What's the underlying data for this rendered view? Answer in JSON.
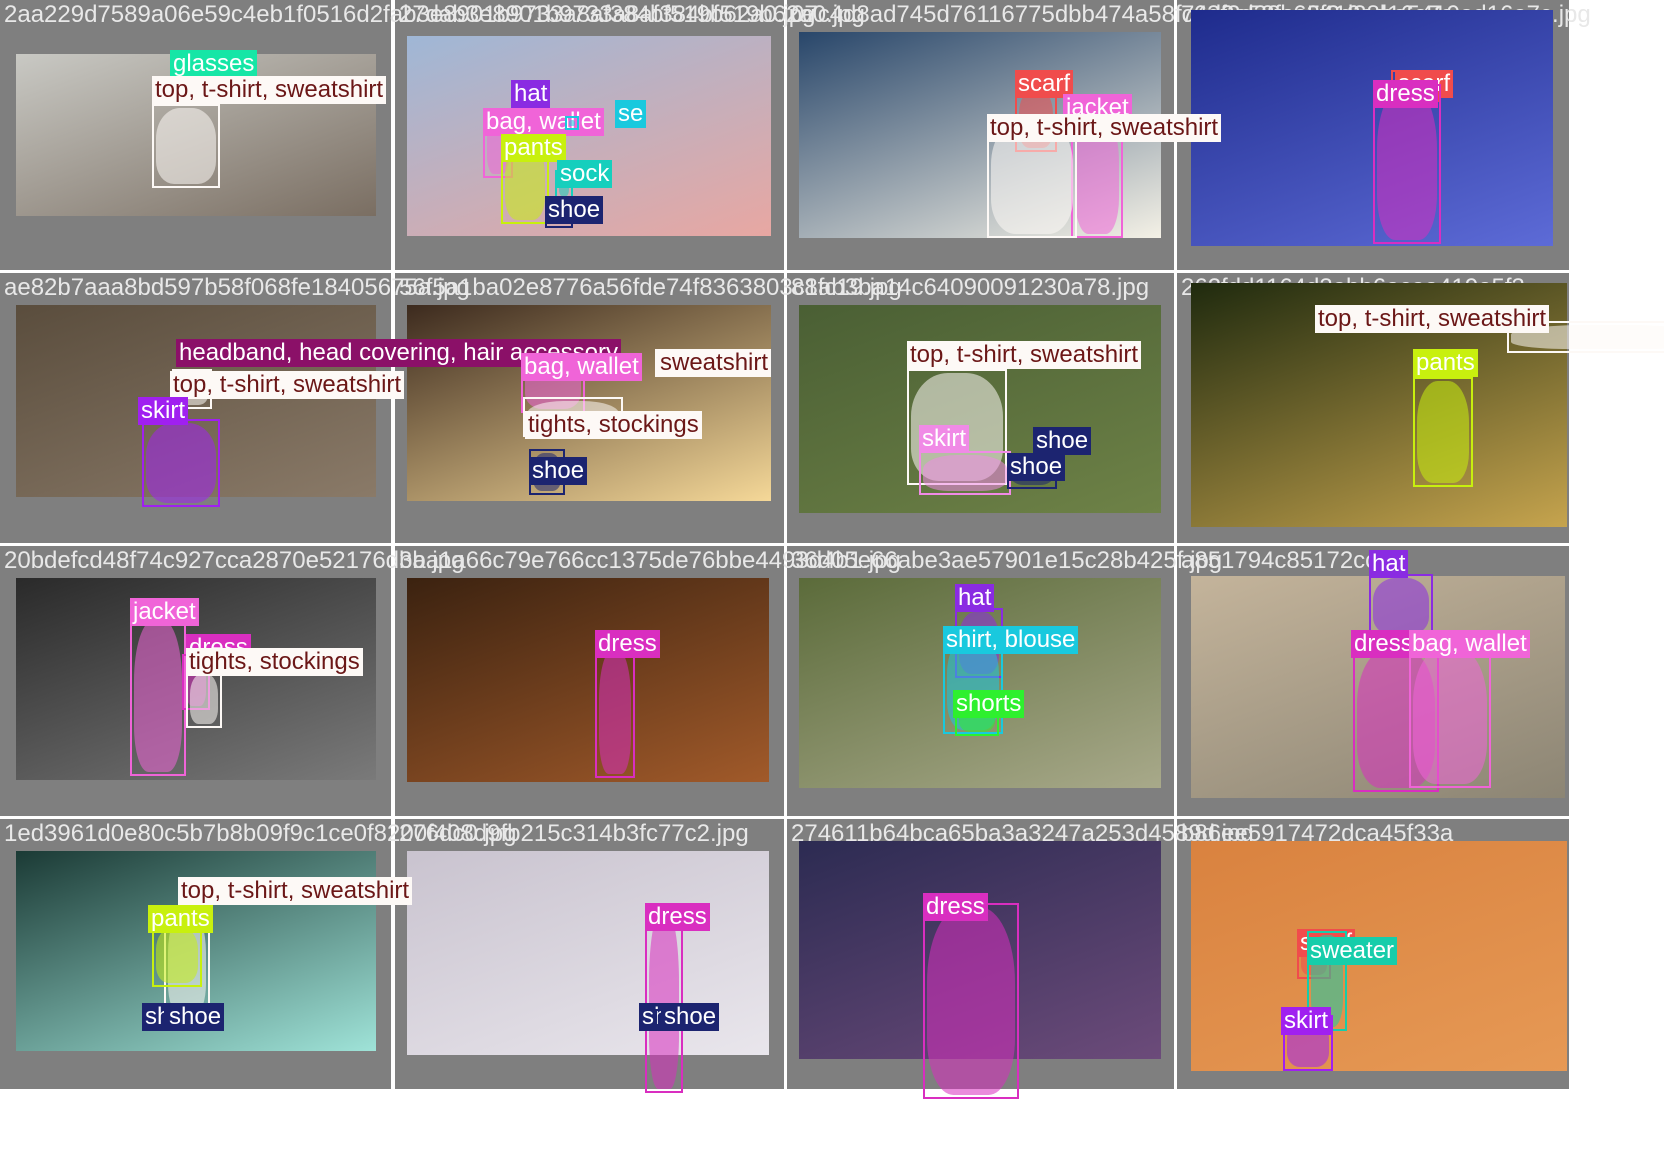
{
  "colors": {
    "background": "#7f7f7f",
    "grid_line": "#ffffff",
    "title_text": "#e8e8e8"
  },
  "tiles": [
    {
      "title": "2aa229d7589a06e59c4eb1f0516d2fab3e8901b9733a8af384bf519b62a0.jpg",
      "photo_colors": [
        "#c9c9c4",
        "#7a6e62"
      ],
      "detections": [
        {
          "label": "glasses",
          "color": "#16e6a6",
          "text": "#ffffff"
        },
        {
          "label": "top, t-shirt, sweatshirt",
          "color": "#fdf9f6",
          "text": "#6b1717"
        }
      ]
    },
    {
      "title": "27dab3e8901b9733a8af384bf519b62a0.jpg",
      "photo_colors": [
        "#9fb7d6",
        "#e8a7a2"
      ],
      "detections": [
        {
          "label": "hat",
          "color": "#8a2be2",
          "text": "#ffffff"
        },
        {
          "label": "bag, wallet",
          "color": "#f064d8",
          "text": "#ffffff"
        },
        {
          "label": "se",
          "color": "#19c9de",
          "text": "#ffffff"
        },
        {
          "label": "pants",
          "color": "#c8f00e",
          "text": "#ffffff"
        },
        {
          "label": "sock",
          "color": "#15cfbd",
          "text": "#ffffff"
        },
        {
          "label": "shoe",
          "color": "#1c2470",
          "text": "#ffffff"
        }
      ]
    },
    {
      "title": "07c4d8ad745d76116775dbb474a58fc63f2d38be5419ad16e7c",
      "photo_colors": [
        "#28466a",
        "#f4f1e6"
      ],
      "detections": [
        {
          "label": "scarf",
          "color": "#f04c4c",
          "text": "#ffffff"
        },
        {
          "label": "jacket",
          "color": "#f064d8",
          "text": "#ffffff"
        },
        {
          "label": "top, t-shirt, sweatshirt",
          "color": "#fdf9f6",
          "text": "#6b1717"
        }
      ]
    },
    {
      "title": "74d0e58fc63f2d38be5419ad16e7c.jpg",
      "photo_colors": [
        "#1e2b8c",
        "#5d6bd7"
      ],
      "detections": [
        {
          "label": "scarf",
          "color": "#f04c4c",
          "text": "#ffffff"
        },
        {
          "label": "dress",
          "color": "#d92ec0",
          "text": "#ffffff"
        }
      ]
    },
    {
      "title": "ae82b7aaa8bd597b58f068fe18405675a.jpg",
      "photo_colors": [
        "#5a4d3d",
        "#8a7a68"
      ],
      "detections": [
        {
          "label": "headband, head covering, hair accessory",
          "color": "#8b1068",
          "text": "#ffffff"
        },
        {
          "label": "top, t-shirt, sweatshirt",
          "color": "#fdf9f6",
          "text": "#6b1717"
        },
        {
          "label": "skirt",
          "color": "#a020f0",
          "text": "#ffffff"
        }
      ]
    },
    {
      "title": "56f5a1ba02e8776a56fde74f8363803c1ab3ba14c64090091230a78.jpg",
      "photo_colors": [
        "#3c2a1e",
        "#f5d898"
      ],
      "detections": [
        {
          "label": "bag, wallet",
          "color": "#f064d8",
          "text": "#ffffff"
        },
        {
          "label": "sweatshirt",
          "color": "#fdf9f6",
          "text": "#6b1717"
        },
        {
          "label": "tights, stockings",
          "color": "#fdf9f6",
          "text": "#6b1717"
        },
        {
          "label": "shoe",
          "color": "#1c2470",
          "text": "#ffffff"
        }
      ]
    },
    {
      "title": "88fc19.jpg",
      "photo_colors": [
        "#4a5f34",
        "#6e8247"
      ],
      "detections": [
        {
          "label": "top, t-shirt, sweatshirt",
          "color": "#fdf9f6",
          "text": "#6b1717"
        },
        {
          "label": "skirt",
          "color": "#f08ae6",
          "text": "#ffffff"
        },
        {
          "label": "shoe",
          "color": "#1c2470",
          "text": "#ffffff"
        },
        {
          "label": "shoe",
          "color": "#1c2470",
          "text": "#ffffff"
        }
      ]
    },
    {
      "title": "262fdd1164d3ebb6acaa419e5f3",
      "photo_colors": [
        "#1f2a0e",
        "#c6a44e"
      ],
      "detections": [
        {
          "label": "top, t-shirt, sweatshirt",
          "color": "#fdf9f6",
          "text": "#6b1717"
        },
        {
          "label": "pants",
          "color": "#c8f00e",
          "text": "#ffffff"
        }
      ]
    },
    {
      "title": "20bdefcd48f74c927cca2870e52176d3a.jpg",
      "photo_colors": [
        "#2a2a2a",
        "#7a7a7a"
      ],
      "detections": [
        {
          "label": "jacket",
          "color": "#f064d8",
          "text": "#ffffff"
        },
        {
          "label": "dress",
          "color": "#d92ec0",
          "text": "#ffffff"
        },
        {
          "label": "tights, stockings",
          "color": "#fdf9f6",
          "text": "#6b1717"
        }
      ]
    },
    {
      "title": "bba1a66c79e766cc1375de76bbe4493d4b1.jpg",
      "photo_colors": [
        "#3b2210",
        "#a15a2a"
      ],
      "detections": [
        {
          "label": "dress",
          "color": "#d92ec0",
          "text": "#ffffff"
        }
      ]
    },
    {
      "title": "36d05e66abe3ae57901e15c28b425f.jpg",
      "photo_colors": [
        "#5b6b3a",
        "#a8a98a"
      ],
      "detections": [
        {
          "label": "hat",
          "color": "#8a2be2",
          "text": "#ffffff"
        },
        {
          "label": "shirt, blouse",
          "color": "#19c9de",
          "text": "#ffffff"
        },
        {
          "label": "shorts",
          "color": "#2ef02e",
          "text": "#ffffff"
        }
      ]
    },
    {
      "title": "a851794c85172cc",
      "photo_colors": [
        "#c4b49b",
        "#8c8574"
      ],
      "detections": [
        {
          "label": "hat",
          "color": "#8a2be2",
          "text": "#ffffff"
        },
        {
          "label": "dress",
          "color": "#d92ec0",
          "text": "#ffffff"
        },
        {
          "label": "bag, wallet",
          "color": "#f064d8",
          "text": "#ffffff"
        }
      ]
    },
    {
      "title": "1ed3961d0e80c5b7b8b09f9c1ce0f8200f408d9fb215c314b3fc77c2.jpg",
      "photo_colors": [
        "#1b3a35",
        "#9fe3d8"
      ],
      "detections": [
        {
          "label": "top, t-shirt, sweatshirt",
          "color": "#fdf9f6",
          "text": "#6b1717"
        },
        {
          "label": "pants",
          "color": "#c8f00e",
          "text": "#ffffff"
        },
        {
          "label": "shoe",
          "color": "#1c2470",
          "text": "#ffffff"
        },
        {
          "label": "shoe",
          "color": "#1c2470",
          "text": "#ffffff"
        }
      ]
    },
    {
      "title": "276dc0.jpg",
      "photo_colors": [
        "#c9c3cf",
        "#e9e6ec"
      ],
      "detections": [
        {
          "label": "dress",
          "color": "#d92ec0",
          "text": "#ffffff"
        },
        {
          "label": "shoe",
          "color": "#1c2470",
          "text": "#ffffff"
        },
        {
          "label": "shoe",
          "color": "#1c2470",
          "text": "#ffffff"
        }
      ]
    },
    {
      "title": "274611b64bca65ba3a3247a253d4589d.jpg",
      "photo_colors": [
        "#2c2b52",
        "#6c4b7a"
      ],
      "detections": [
        {
          "label": "dress",
          "color": "#d92ec0",
          "text": "#ffffff"
        }
      ]
    },
    {
      "title": "b86ee5917472dca45f33a",
      "photo_colors": [
        "#d9823f",
        "#e69955"
      ],
      "detections": [
        {
          "label": "scarf",
          "color": "#f04c4c",
          "text": "#ffffff"
        },
        {
          "label": "sweater",
          "color": "#16cdaa",
          "text": "#ffffff"
        },
        {
          "label": "skirt",
          "color": "#a020f0",
          "text": "#ffffff"
        }
      ]
    }
  ]
}
